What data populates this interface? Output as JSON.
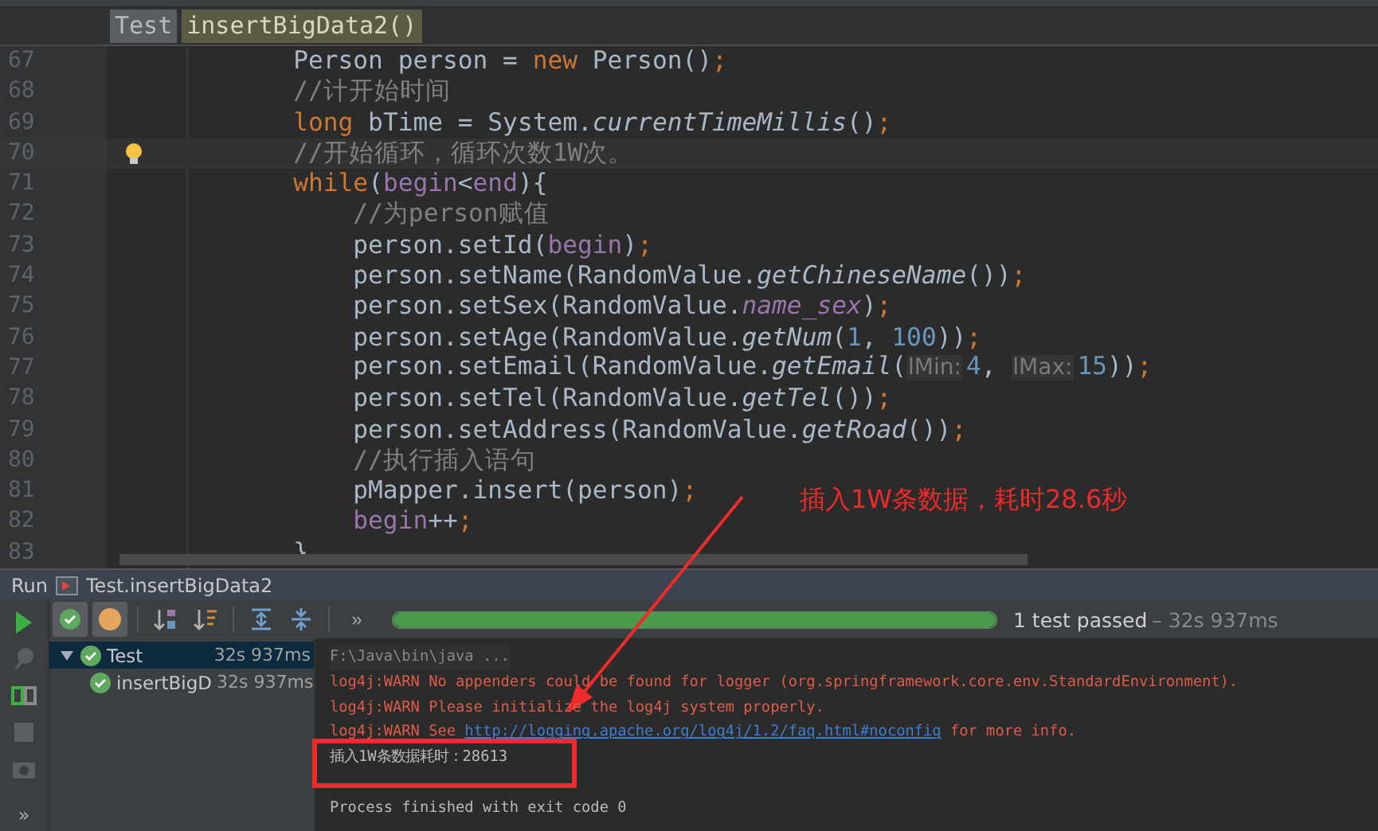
{
  "breadcrumb": [
    {
      "label": "Test",
      "kind": "class"
    },
    {
      "label": "insertBigData2()",
      "kind": "method"
    }
  ],
  "editor": {
    "lines": [
      {
        "number": "67",
        "current": false,
        "tokens": [
          {
            "kind": "plain",
            "text": "        Person person = "
          },
          {
            "kind": "kw",
            "text": "new"
          },
          {
            "kind": "plain",
            "text": " Person()"
          },
          {
            "kind": "semi",
            "text": ";"
          }
        ]
      },
      {
        "number": "68",
        "current": false,
        "tokens": [
          {
            "kind": "comment",
            "text": "        //计开始时间"
          }
        ]
      },
      {
        "number": "69",
        "current": false,
        "tokens": [
          {
            "kind": "kw",
            "text": "        long"
          },
          {
            "kind": "plain",
            "text": " bTime = System."
          },
          {
            "kind": "method",
            "text": "currentTimeMillis"
          },
          {
            "kind": "plain",
            "text": "()"
          },
          {
            "kind": "semi",
            "text": ";"
          }
        ]
      },
      {
        "number": "70",
        "current": true,
        "tokens": [
          {
            "kind": "comment",
            "text": "        //开始循环，循环次数1W次。"
          }
        ]
      },
      {
        "number": "71",
        "current": false,
        "tokens": [
          {
            "kind": "kw",
            "text": "        while"
          },
          {
            "kind": "plain",
            "text": "("
          },
          {
            "kind": "var",
            "text": "begin"
          },
          {
            "kind": "plain",
            "text": "<"
          },
          {
            "kind": "var",
            "text": "end"
          },
          {
            "kind": "plain",
            "text": "){"
          }
        ]
      },
      {
        "number": "72",
        "current": false,
        "tokens": [
          {
            "kind": "comment",
            "text": "            //为person赋值"
          }
        ]
      },
      {
        "number": "73",
        "current": false,
        "tokens": [
          {
            "kind": "plain",
            "text": "            person.setId("
          },
          {
            "kind": "var",
            "text": "begin"
          },
          {
            "kind": "plain",
            "text": ")"
          },
          {
            "kind": "semi",
            "text": ";"
          }
        ]
      },
      {
        "number": "74",
        "current": false,
        "tokens": [
          {
            "kind": "plain",
            "text": "            person.setName(RandomValue."
          },
          {
            "kind": "method",
            "text": "getChineseName"
          },
          {
            "kind": "plain",
            "text": "())"
          },
          {
            "kind": "semi",
            "text": ";"
          }
        ]
      },
      {
        "number": "75",
        "current": false,
        "tokens": [
          {
            "kind": "plain",
            "text": "            person.setSex(RandomValue."
          },
          {
            "kind": "field",
            "text": "name_sex"
          },
          {
            "kind": "plain",
            "text": ")"
          },
          {
            "kind": "semi",
            "text": ";"
          }
        ]
      },
      {
        "number": "76",
        "current": false,
        "tokens": [
          {
            "kind": "plain",
            "text": "            person.setAge(RandomValue."
          },
          {
            "kind": "method",
            "text": "getNum"
          },
          {
            "kind": "plain",
            "text": "("
          },
          {
            "kind": "num",
            "text": "1"
          },
          {
            "kind": "plain",
            "text": ", "
          },
          {
            "kind": "num",
            "text": "100"
          },
          {
            "kind": "plain",
            "text": "))"
          },
          {
            "kind": "semi",
            "text": ";"
          }
        ]
      },
      {
        "number": "77",
        "current": false,
        "tokens": [
          {
            "kind": "plain",
            "text": "            person.setEmail(RandomValue."
          },
          {
            "kind": "method",
            "text": "getEmail"
          },
          {
            "kind": "plain",
            "text": "("
          },
          {
            "kind": "hint",
            "text": "lMin:"
          },
          {
            "kind": "num",
            "text": "4"
          },
          {
            "kind": "plain",
            "text": ", "
          },
          {
            "kind": "hint",
            "text": "lMax:"
          },
          {
            "kind": "num",
            "text": "15"
          },
          {
            "kind": "plain",
            "text": "))"
          },
          {
            "kind": "semi",
            "text": ";"
          }
        ]
      },
      {
        "number": "78",
        "current": false,
        "tokens": [
          {
            "kind": "plain",
            "text": "            person.setTel(RandomValue."
          },
          {
            "kind": "method",
            "text": "getTel"
          },
          {
            "kind": "plain",
            "text": "())"
          },
          {
            "kind": "semi",
            "text": ";"
          }
        ]
      },
      {
        "number": "79",
        "current": false,
        "tokens": [
          {
            "kind": "plain",
            "text": "            person.setAddress(RandomValue."
          },
          {
            "kind": "method",
            "text": "getRoad"
          },
          {
            "kind": "plain",
            "text": "())"
          },
          {
            "kind": "semi",
            "text": ";"
          }
        ]
      },
      {
        "number": "80",
        "current": false,
        "tokens": [
          {
            "kind": "comment",
            "text": "            //执行插入语句"
          }
        ]
      },
      {
        "number": "81",
        "current": false,
        "tokens": [
          {
            "kind": "plain",
            "text": "            pMapper.insert(person)"
          },
          {
            "kind": "semi",
            "text": ";"
          }
        ]
      },
      {
        "number": "82",
        "current": false,
        "tokens": [
          {
            "kind": "var",
            "text": "            begin"
          },
          {
            "kind": "plain",
            "text": "++"
          },
          {
            "kind": "semi",
            "text": ";"
          }
        ]
      },
      {
        "number": "83",
        "current": false,
        "tokens": [
          {
            "kind": "plain",
            "text": "        }"
          }
        ]
      }
    ]
  },
  "annotation": {
    "text": "插入1W条数据，耗时28.6秒"
  },
  "run": {
    "label": "Run",
    "config": "Test.insertBigData2",
    "side_tools": [
      {
        "kind": "play"
      },
      {
        "kind": "pin"
      },
      {
        "kind": "rerun"
      },
      {
        "kind": "stop"
      },
      {
        "kind": "camera"
      },
      {
        "kind": "more",
        "text": "»"
      }
    ],
    "toolbar": [
      {
        "kind": "passed",
        "selected": true
      },
      {
        "kind": "ignored",
        "selected": true
      },
      {
        "kind": "sort-alpha",
        "selected": false
      },
      {
        "kind": "sort-duration",
        "selected": false
      },
      {
        "kind": "expand",
        "selected": false
      },
      {
        "kind": "collapse",
        "selected": false
      },
      {
        "kind": "more",
        "text": "»",
        "selected": false
      }
    ],
    "progress": {
      "level": 1
    },
    "status": {
      "text": "1 test passed",
      "duration": "– 32s 937ms"
    },
    "tree": [
      {
        "label": "Test",
        "time": "32s 937ms",
        "selected": true,
        "expanded": true,
        "children": [
          {
            "label": "insertBigD",
            "time": "32s 937ms",
            "selected": false
          }
        ]
      }
    ],
    "console": [
      {
        "kind": "command",
        "parts": [
          {
            "text": "F:\\Java\\bin\\java ...",
            "link": false
          }
        ]
      },
      {
        "kind": "error",
        "parts": [
          {
            "text": "log4j:WARN No appenders could be found for logger (org.springframework.core.env.StandardEnvironment).",
            "link": false
          }
        ]
      },
      {
        "kind": "error",
        "parts": [
          {
            "text": "log4j:WARN Please initialize the log4j system properly.",
            "link": false
          }
        ]
      },
      {
        "kind": "error",
        "parts": [
          {
            "text": "log4j:WARN See ",
            "link": false
          },
          {
            "text": "http://logging.apache.org/log4j/1.2/faq.html#noconfig",
            "link": true
          },
          {
            "text": " for more info.",
            "link": false
          }
        ]
      },
      {
        "kind": "output",
        "parts": [
          {
            "text": "插入1W条数据耗时：28613",
            "link": false
          }
        ]
      },
      {
        "kind": "exit",
        "parts": [
          {
            "text": "Process finished with exit code 0",
            "link": false
          }
        ]
      }
    ]
  }
}
